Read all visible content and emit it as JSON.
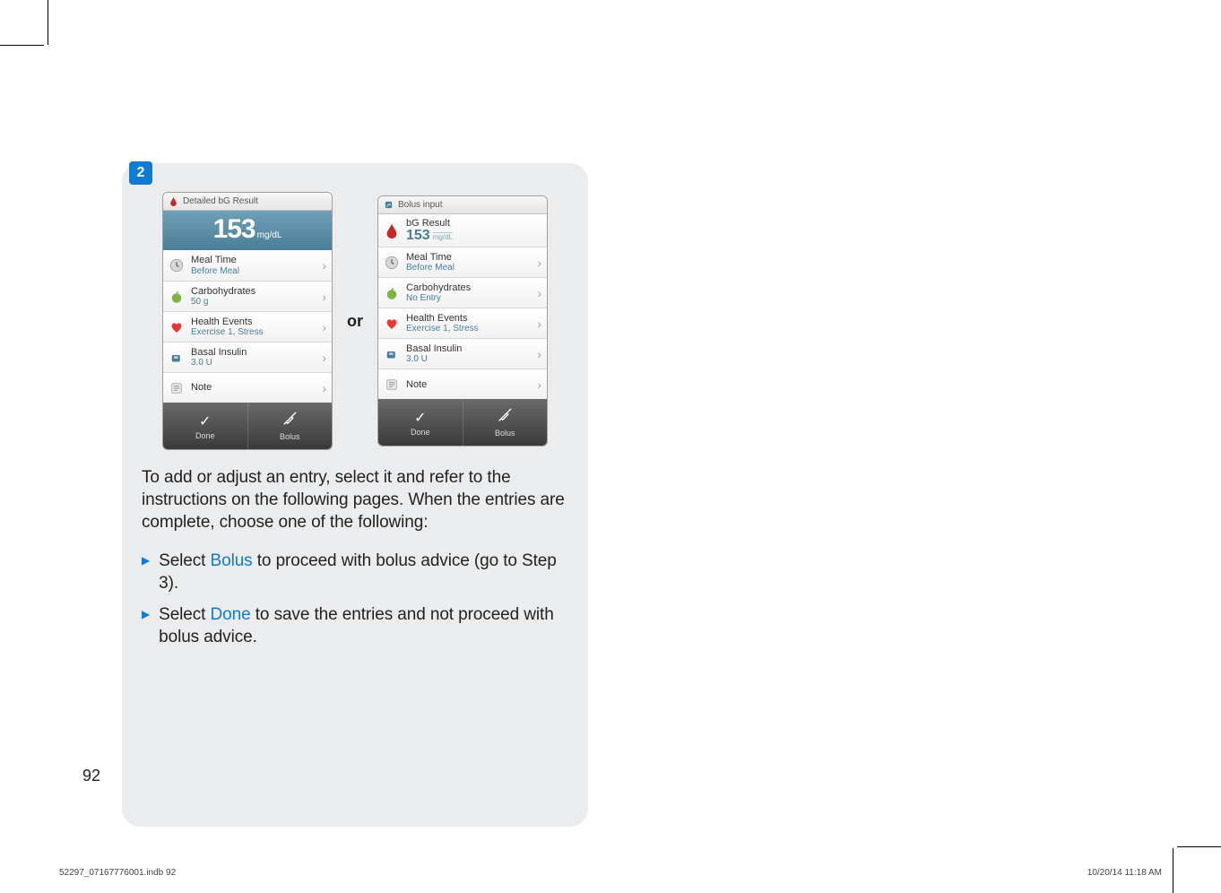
{
  "step_number": "2",
  "or_label": "or",
  "screens": {
    "left": {
      "title": "Detailed bG Result",
      "big_result_value": "153",
      "big_result_unit": "mg/dL",
      "rows": [
        {
          "label": "Meal Time",
          "value": "Before Meal"
        },
        {
          "label": "Carbohydrates",
          "value": "50 g"
        },
        {
          "label": "Health Events",
          "value": "Exercise 1, Stress"
        },
        {
          "label": "Basal Insulin",
          "value": "3.0 U"
        },
        {
          "label": "Note",
          "value": ""
        }
      ],
      "bottom": {
        "done": "Done",
        "bolus": "Bolus"
      }
    },
    "right": {
      "title": "Bolus input",
      "bg_row": {
        "label": "bG Result",
        "value": "153",
        "unit": "mg/dL"
      },
      "rows": [
        {
          "label": "Meal Time",
          "value": "Before Meal"
        },
        {
          "label": "Carbohydrates",
          "value": "No Entry"
        },
        {
          "label": "Health Events",
          "value": "Exercise 1, Stress"
        },
        {
          "label": "Basal Insulin",
          "value": "3.0 U"
        },
        {
          "label": "Note",
          "value": ""
        }
      ],
      "bottom": {
        "done": "Done",
        "bolus": "Bolus"
      }
    }
  },
  "body": {
    "intro": "To add or adjust an entry, select it and refer to the instructions on the following pages. When the entries are complete, choose one of the following:",
    "bullets": [
      {
        "pre": "Select ",
        "link": "Bolus",
        "post": " to proceed with bolus advice (go to Step 3)."
      },
      {
        "pre": "Select ",
        "link": "Done",
        "post": " to save the entries and not proceed with bolus advice."
      }
    ]
  },
  "page_number": "92",
  "footer": {
    "file_and_page": "52297_07167776001.indb   92",
    "timestamp": "10/20/14   11:18 AM"
  }
}
